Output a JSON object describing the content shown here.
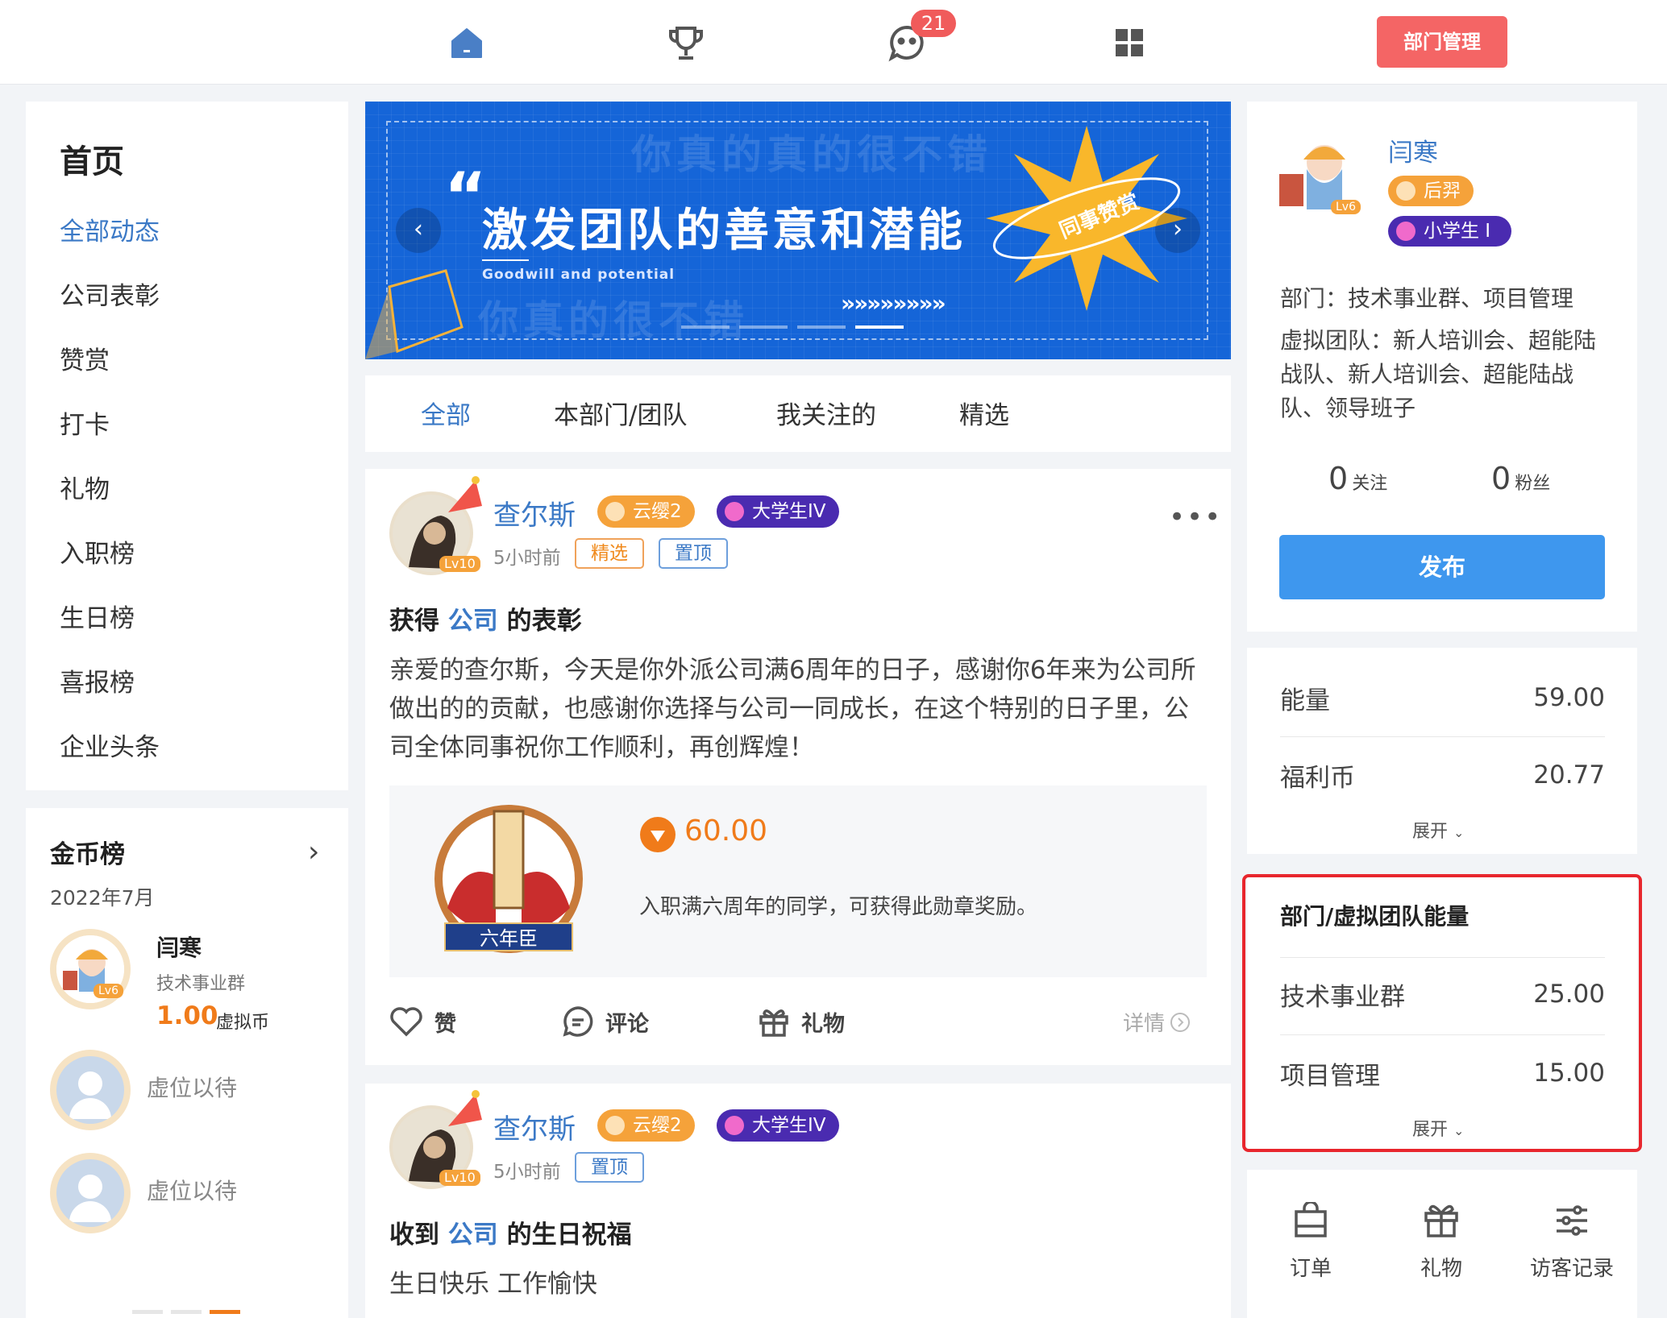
{
  "topnav": {
    "home_icon": "home-icon",
    "trophy_icon": "trophy-icon",
    "message_icon": "message-icon",
    "message_badge": "21",
    "apps_icon": "grid-icon",
    "dept_button": "部门管理"
  },
  "sidebar": {
    "title": "首页",
    "items": [
      {
        "label": "全部动态",
        "active": true
      },
      {
        "label": "公司表彰"
      },
      {
        "label": "赞赏"
      },
      {
        "label": "打卡"
      },
      {
        "label": "礼物"
      },
      {
        "label": "入职榜"
      },
      {
        "label": "生日榜"
      },
      {
        "label": "喜报榜"
      },
      {
        "label": "企业头条"
      }
    ]
  },
  "coin_rank": {
    "title": "金币榜",
    "date": "2022年7月",
    "first": {
      "name": "闫寒",
      "level": "Lv6",
      "dept": "技术事业群",
      "amount": "1.00",
      "unit": "虚拟币"
    },
    "vacant_1": "虚位以待",
    "vacant_2": "虚位以待"
  },
  "banner": {
    "quote_mark": "“",
    "main_text": "激发团队的善意和潜能",
    "sub_text": "Goodwill and potential",
    "ghost_top": "你真的真的很不错",
    "ghost_bottom": "你真的很不错",
    "burst_text": "同事赞赏",
    "chevrons": "»»»»»»»»",
    "prev": "‹",
    "next": "›"
  },
  "feed_tabs": [
    {
      "label": "全部",
      "active": true
    },
    {
      "label": "本部门/团队"
    },
    {
      "label": "我关注的"
    },
    {
      "label": "精选"
    }
  ],
  "posts": [
    {
      "author": "查尔斯",
      "level": "Lv10",
      "tag1": "云缨2",
      "tag2": "大学生IV",
      "time": "5小时前",
      "pill1": "精选",
      "pill2": "置顶",
      "title_prefix": "获得",
      "title_highlight": "公司",
      "title_suffix": "的表彰",
      "body": "亲爱的查尔斯，今天是你外派公司满6周年的日子，感谢你6年来为公司所做出的的贡献，也感谢你选择与公司一同成长，在这个特别的日子里，公司全体同事祝你工作顺利，再创辉煌！",
      "medal_name": "六年臣",
      "medal_value": "60.00",
      "medal_desc": "入职满六周年的同学，可获得此勋章奖励。",
      "like": "赞",
      "comment": "评论",
      "gift": "礼物",
      "detail": "详情",
      "more": "•••"
    },
    {
      "author": "查尔斯",
      "level": "Lv10",
      "tag1": "云缨2",
      "tag2": "大学生IV",
      "time": "5小时前",
      "pill": "置顶",
      "title_prefix": "收到",
      "title_highlight": "公司",
      "title_suffix": "的生日祝福",
      "body": "生日快乐 工作愉快"
    }
  ],
  "profile": {
    "name": "闫寒",
    "level": "Lv6",
    "tag1": "后羿",
    "tag2": "小学生 I",
    "dept": "部门：技术事业群、项目管理",
    "virtual_team": "虚拟团队：新人培训会、超能陆战队、新人培训会、超能陆战队、领导班子",
    "follow_count": "0",
    "follow_label": "关注",
    "fans_count": "0",
    "fans_label": "粉丝",
    "publish": "发布"
  },
  "wallet": {
    "energy_label": "能量",
    "energy_value": "59.00",
    "welfare_label": "福利币",
    "welfare_value": "20.77",
    "expand": "展开"
  },
  "team_energy": {
    "title": "部门/虚拟团队能量",
    "rows": [
      {
        "label": "技术事业群",
        "value": "25.00"
      },
      {
        "label": "项目管理",
        "value": "15.00"
      }
    ],
    "expand": "展开"
  },
  "tools": [
    {
      "label": "订单",
      "icon": "bag-icon"
    },
    {
      "label": "礼物",
      "icon": "gift-icon"
    },
    {
      "label": "访客记录",
      "icon": "sliders-icon"
    }
  ],
  "colors": {
    "accent_blue": "#3b79c6",
    "publish_blue": "#3e97ee",
    "dept_red": "#f46565",
    "highlight_red": "#e8262d",
    "coin_orange": "#f07b1a"
  }
}
